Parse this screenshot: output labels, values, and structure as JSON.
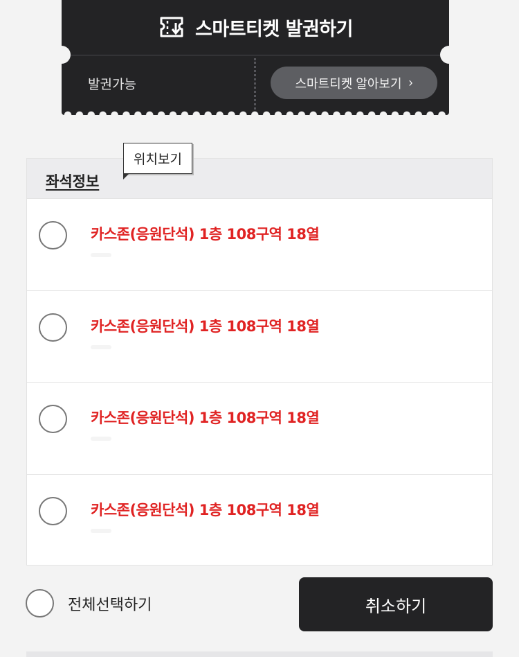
{
  "ticket": {
    "title": "스마트티켓 발권하기",
    "icon": "ticket-download-icon",
    "status": "발권가능",
    "info_button_label": "스마트티켓 알아보기",
    "info_button_chevron": "›"
  },
  "seat_info": {
    "header_title": "좌석정보",
    "tooltip": "위치보기",
    "seats": [
      {
        "name": "카스존(응원단석) 1층 108구역 18열"
      },
      {
        "name": "카스존(응원단석) 1층 108구역 18열"
      },
      {
        "name": "카스존(응원단석) 1층 108구역 18열"
      },
      {
        "name": "카스존(응원단석) 1층 108구역 18열"
      }
    ]
  },
  "footer": {
    "select_all_label": "전체선택하기",
    "cancel_label": "취소하기"
  },
  "colors": {
    "background": "#f3f3f3",
    "ticket_dark": "#232325",
    "seat_text_red": "#e02323",
    "pill_gray": "#5d5e62"
  }
}
